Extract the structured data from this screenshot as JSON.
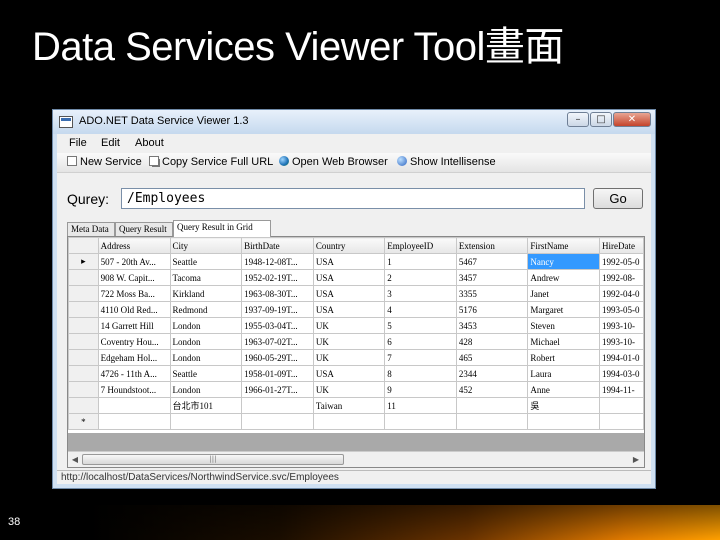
{
  "slide": {
    "title": "Data Services Viewer Tool畫面",
    "number": "38"
  },
  "window": {
    "title": "ADO.NET Data Service Viewer 1.3",
    "min_glyph": "–",
    "max_glyph": "□",
    "close_glyph": "✕"
  },
  "menu": [
    "File",
    "Edit",
    "About"
  ],
  "toolbar": {
    "new_service": "New Service",
    "copy_url": "Copy Service Full URL",
    "open_browser": "Open Web Browser",
    "show_intellisense": "Show Intellisense"
  },
  "query": {
    "label": "Qurey:",
    "value": "/Employees",
    "go_label": "Go"
  },
  "tabs": [
    "Meta Data",
    "Query Result",
    "Query Result in Grid"
  ],
  "grid": {
    "columns": [
      "Address",
      "City",
      "BirthDate",
      "Country",
      "EmployeeID",
      "Extension",
      "FirstName",
      "HireDate"
    ],
    "rows": [
      [
        "507 - 20th Av...",
        "Seattle",
        "1948-12-08T...",
        "USA",
        "1",
        "5467",
        "Nancy",
        "1992-05-0"
      ],
      [
        "908 W. Capit...",
        "Tacoma",
        "1952-02-19T...",
        "USA",
        "2",
        "3457",
        "Andrew",
        "1992-08-"
      ],
      [
        "722 Moss Ba...",
        "Kirkland",
        "1963-08-30T...",
        "USA",
        "3",
        "3355",
        "Janet",
        "1992-04-0"
      ],
      [
        "4110 Old Red...",
        "Redmond",
        "1937-09-19T...",
        "USA",
        "4",
        "5176",
        "Margaret",
        "1993-05-0"
      ],
      [
        "14 Garrett Hill",
        "London",
        "1955-03-04T...",
        "UK",
        "5",
        "3453",
        "Steven",
        "1993-10-"
      ],
      [
        "Coventry Hou...",
        "London",
        "1963-07-02T...",
        "UK",
        "6",
        "428",
        "Michael",
        "1993-10-"
      ],
      [
        "Edgeham Hol...",
        "London",
        "1960-05-29T...",
        "UK",
        "7",
        "465",
        "Robert",
        "1994-01-0"
      ],
      [
        "4726 - 11th A...",
        "Seattle",
        "1958-01-09T...",
        "USA",
        "8",
        "2344",
        "Laura",
        "1994-03-0"
      ],
      [
        "7 Houndstoot...",
        "London",
        "1966-01-27T...",
        "UK",
        "9",
        "452",
        "Anne",
        "1994-11-"
      ],
      [
        "",
        "台北市101",
        "",
        "Taiwan",
        "11",
        "",
        "吳",
        ""
      ]
    ],
    "selected_row_marker": "▸",
    "new_row_marker": "*",
    "scroll_left": "◀",
    "scroll_right": "▶",
    "scroll_grip": "|||"
  },
  "status": {
    "url": "http://localhost/DataServices/NorthwindService.svc/Employees"
  }
}
